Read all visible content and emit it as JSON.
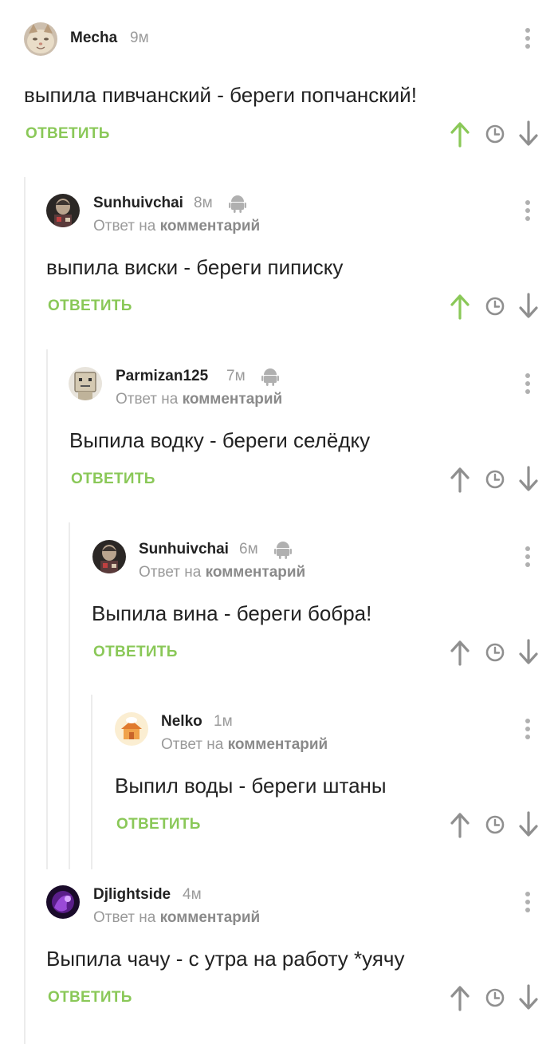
{
  "labels": {
    "reply_prefix": "Ответ на",
    "reply_link": "комментарий",
    "reply_button": "ОТВЕТИТЬ"
  },
  "colors": {
    "accent_green": "#8ac858",
    "upvoted_green": "#8ac858",
    "muted": "#9a9a9a",
    "icon_gray": "#8f8f8f",
    "thread_line": "#ececec"
  },
  "comments": [
    {
      "author": "Mecha",
      "time": "9м",
      "android": false,
      "is_reply": false,
      "text": "выпила пивчанский - береги попчанский!",
      "upvoted": true,
      "avatar": "cat-avatar"
    },
    {
      "author": "Sunhuivchai",
      "time": "8м",
      "android": true,
      "is_reply": true,
      "text": "выпила виски - береги пиписку",
      "upvoted": true,
      "avatar": "dark-avatar"
    },
    {
      "author": "Parmizan125",
      "time": "7м",
      "android": true,
      "is_reply": true,
      "text": "Выпила водку - береги селёдку",
      "upvoted": false,
      "avatar": "robot-avatar"
    },
    {
      "author": "Sunhuivchai",
      "time": "6м",
      "android": true,
      "is_reply": true,
      "text": "Выпила вина - береги бобра!",
      "upvoted": false,
      "avatar": "dark-avatar"
    },
    {
      "author": "Nelko",
      "time": "1м",
      "android": false,
      "is_reply": true,
      "text": "Выпил воды - береги штаны",
      "upvoted": false,
      "avatar": "house-avatar"
    },
    {
      "author": "Djlightside",
      "time": "4м",
      "android": false,
      "is_reply": true,
      "text": "Выпила чачу - с утра на работу *уячу",
      "upvoted": false,
      "avatar": "purple-avatar"
    }
  ]
}
